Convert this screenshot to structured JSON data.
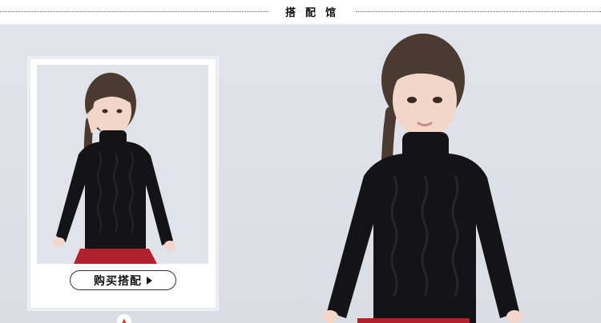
{
  "header": {
    "title": "搭配馆"
  },
  "card": {
    "button_label": "购买搭配"
  },
  "colors": {
    "background": "#dde0e7",
    "sweater": "#141416",
    "skirt": "#b3212c",
    "button_border": "#333333"
  },
  "icons": {
    "button_arrow": "play-triangle-icon",
    "badge": "chevron-up-icon"
  }
}
